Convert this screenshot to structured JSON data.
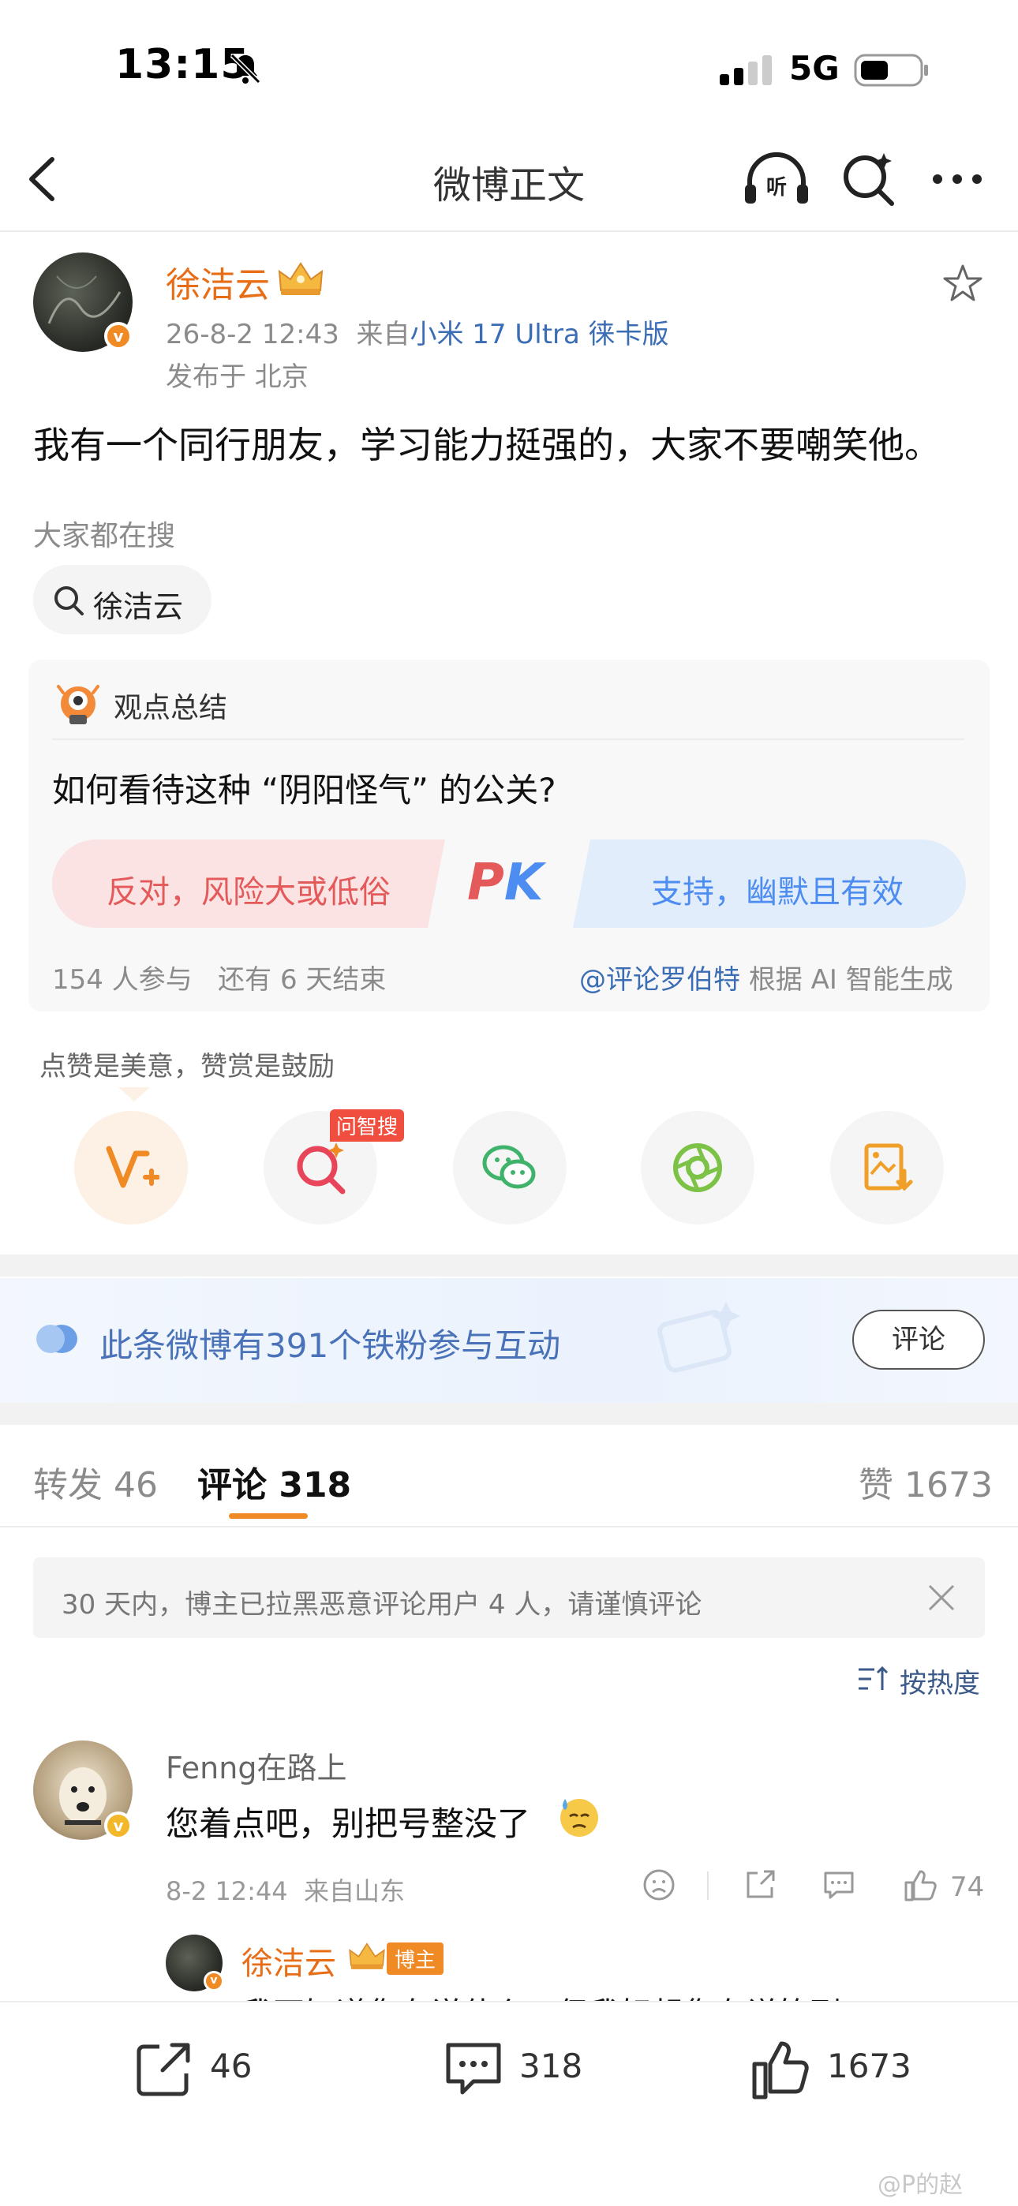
{
  "status_bar": {
    "time": "13:15",
    "network": "5G"
  },
  "nav": {
    "title": "微博正文"
  },
  "post": {
    "author": "徐洁云",
    "verified_mark": "v",
    "time": "26-8-2 12:43",
    "from_prefix": "来自",
    "source": "小米 17 Ultra 徕卡版",
    "location": "发布于 北京",
    "text": "我有一个同行朋友，学习能力挺强的，大家不要嘲笑他。"
  },
  "trending": {
    "label": "大家都在搜",
    "chip": "徐洁云"
  },
  "opinion": {
    "header": "观点总结",
    "question": "如何看待这种 “阴阳怪气” 的公关?",
    "oppose": "反对，风险大或低俗",
    "pk_left": "P",
    "pk_right": "K",
    "support": "支持，幽默且有效",
    "participants": "154 人参与",
    "remaining": "还有 6 天结束",
    "credit_user": "@评论罗伯特",
    "credit_suffix": "根据 AI 智能生成"
  },
  "tip": "点赞是美意，赞赏是鼓励",
  "actions": {
    "badge": "问智搜",
    "icons": [
      "reward-icon",
      "smart-search-icon",
      "wechat-icon",
      "moments-icon",
      "save-image-icon"
    ]
  },
  "fans": {
    "text": "此条微博有391个铁粉参与互动",
    "button": "评论"
  },
  "tabs": {
    "repost_label": "转发",
    "repost_count": "46",
    "comment_label": "评论",
    "comment_count": "318",
    "like_label": "赞",
    "like_count": "1673"
  },
  "notice": {
    "text": "30 天内，博主已拉黑恶意评论用户 4 人，请谨慎评论"
  },
  "sort": {
    "label": "按热度"
  },
  "comment": {
    "user": "Fenng在路上",
    "text": "您着点吧，别把号整没了",
    "time": "8-2 12:44",
    "location": "来自山东",
    "likes": "74",
    "reply_user": "徐洁云",
    "reply_badge": "博主",
    "reply_preview": "我不知道您在说什么，但我好想您在说笑到"
  },
  "bottom": {
    "repost": "46",
    "comment": "318",
    "like": "1673"
  },
  "watermark": "@P的赵",
  "colors": {
    "accent": "#f08a24",
    "author": "#e86d17",
    "link": "#3b6db5",
    "oppose": "#e45a5a",
    "support": "#4d8cf0"
  }
}
